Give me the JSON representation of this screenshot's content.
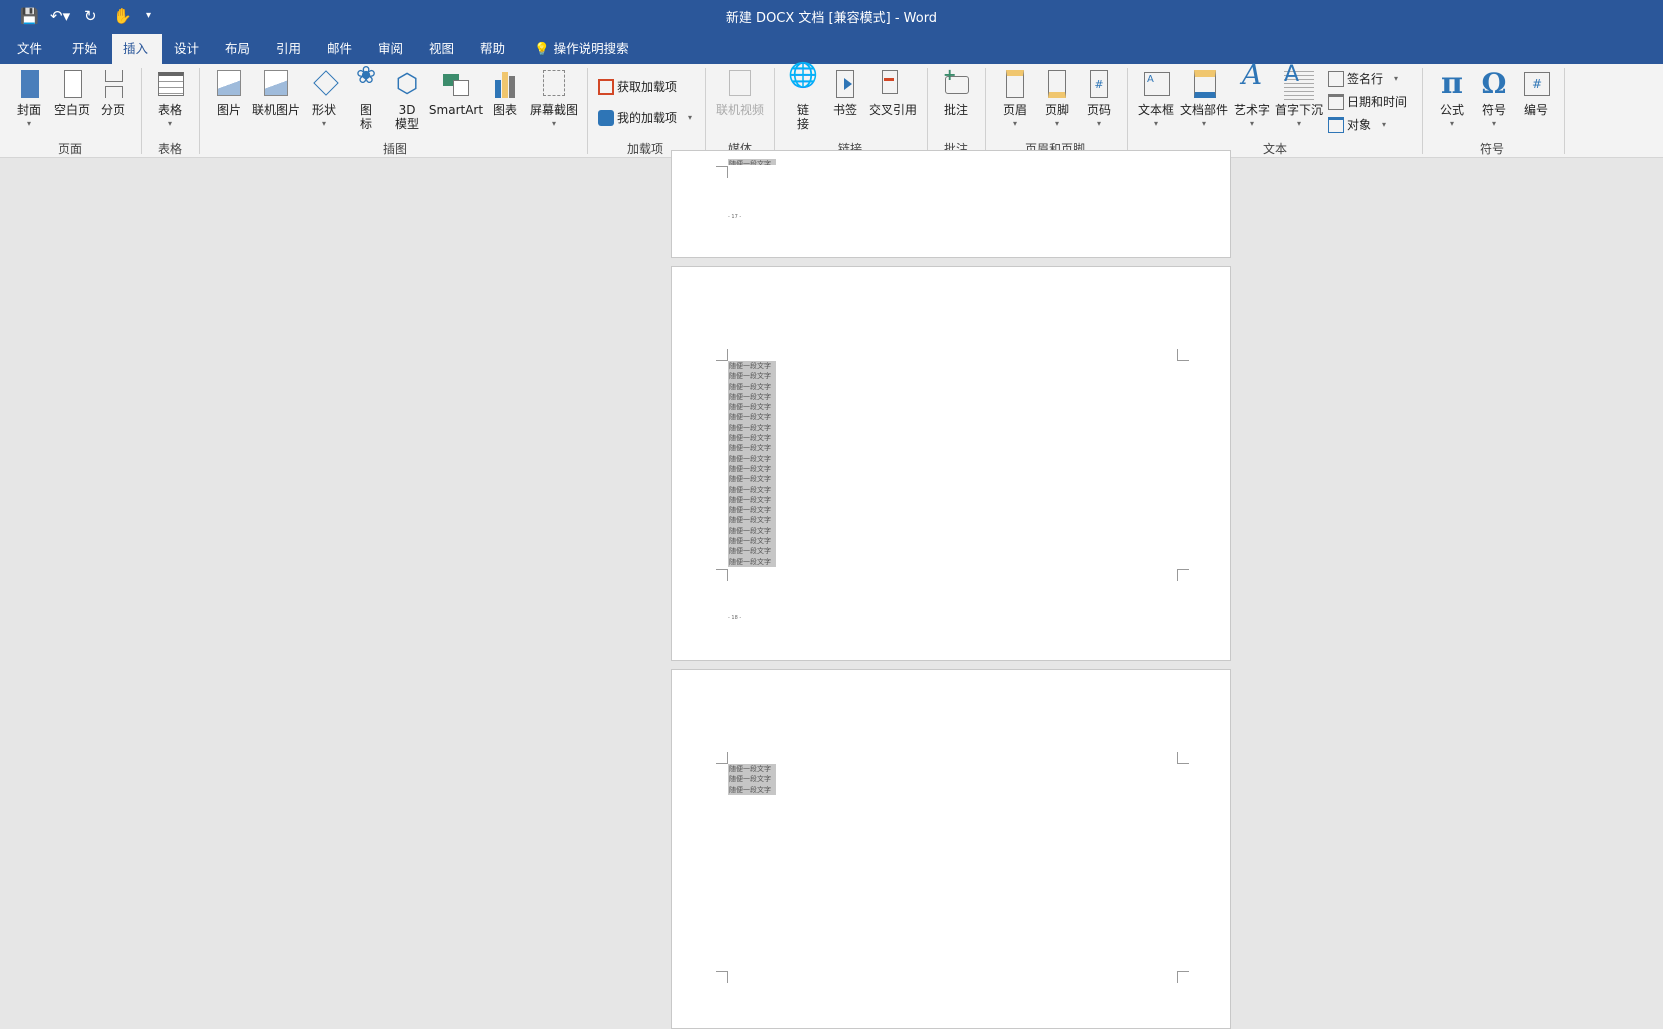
{
  "window": {
    "title": "新建 DOCX 文档 [兼容模式]  -  Word"
  },
  "quick_access": [
    "save-icon",
    "undo-icon",
    "redo-icon",
    "touch-mode-icon",
    "customize-icon"
  ],
  "tabs": [
    "文件",
    "开始",
    "插入",
    "设计",
    "布局",
    "引用",
    "邮件",
    "审阅",
    "视图",
    "帮助"
  ],
  "active_tab": "插入",
  "tell_me": "操作说明搜索",
  "ribbon": {
    "groups": [
      "页面",
      "表格",
      "插图",
      "加载项",
      "媒体",
      "链接",
      "批注",
      "页眉和页脚",
      "文本",
      "符号"
    ],
    "pages": [
      "封面",
      "空白页",
      "分页"
    ],
    "table": "表格",
    "illustrations": [
      "图片",
      "联机图片",
      "形状",
      "图\n标",
      "3D\n模型",
      "SmartArt",
      "图表",
      "屏幕截图"
    ],
    "addins": [
      "获取加载项",
      "我的加载项"
    ],
    "media": "联机视频",
    "links": [
      "链\n接",
      "书签",
      "交叉引用"
    ],
    "comment": "批注",
    "header_footer": [
      "页眉",
      "页脚",
      "页码"
    ],
    "text": [
      "文本框",
      "文档部件",
      "艺术字",
      "首字下沉"
    ],
    "text_small": [
      "签名行",
      "日期和时间",
      "对象"
    ],
    "symbols": [
      "公式",
      "符号",
      "编号"
    ]
  },
  "document": {
    "line_text": "随便一段文字",
    "page_numbers": [
      "- 17 -",
      "- 18 -"
    ]
  }
}
